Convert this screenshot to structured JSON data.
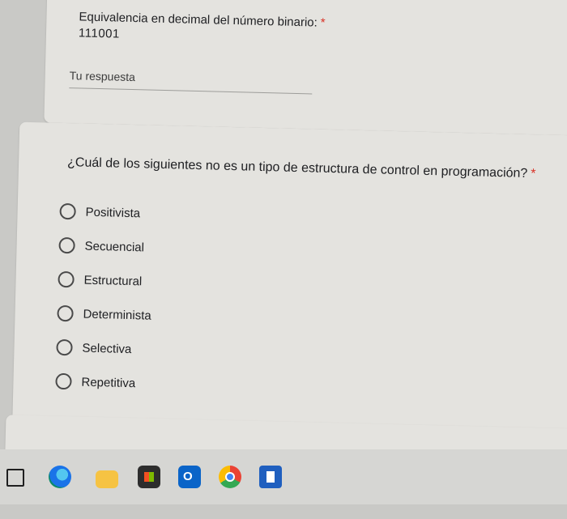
{
  "question1": {
    "title": "Equivalencia en decimal del número binario:",
    "required_mark": "*",
    "description": "111001",
    "answer_placeholder": "Tu respuesta"
  },
  "question2": {
    "title": "¿Cuál de los siguientes no es un tipo de estructura de control en programación?",
    "required_mark": "*",
    "options": [
      "Positivista",
      "Secuencial",
      "Estructural",
      "Determinista",
      "Selectiva",
      "Repetitiva"
    ]
  },
  "taskbar": {
    "icons": [
      "ai-icon",
      "edge-icon",
      "file-explorer-icon",
      "store-icon",
      "outlook-icon",
      "chrome-icon",
      "app-icon"
    ]
  },
  "colors": {
    "required": "#d93025",
    "card": "#e4e3df"
  }
}
